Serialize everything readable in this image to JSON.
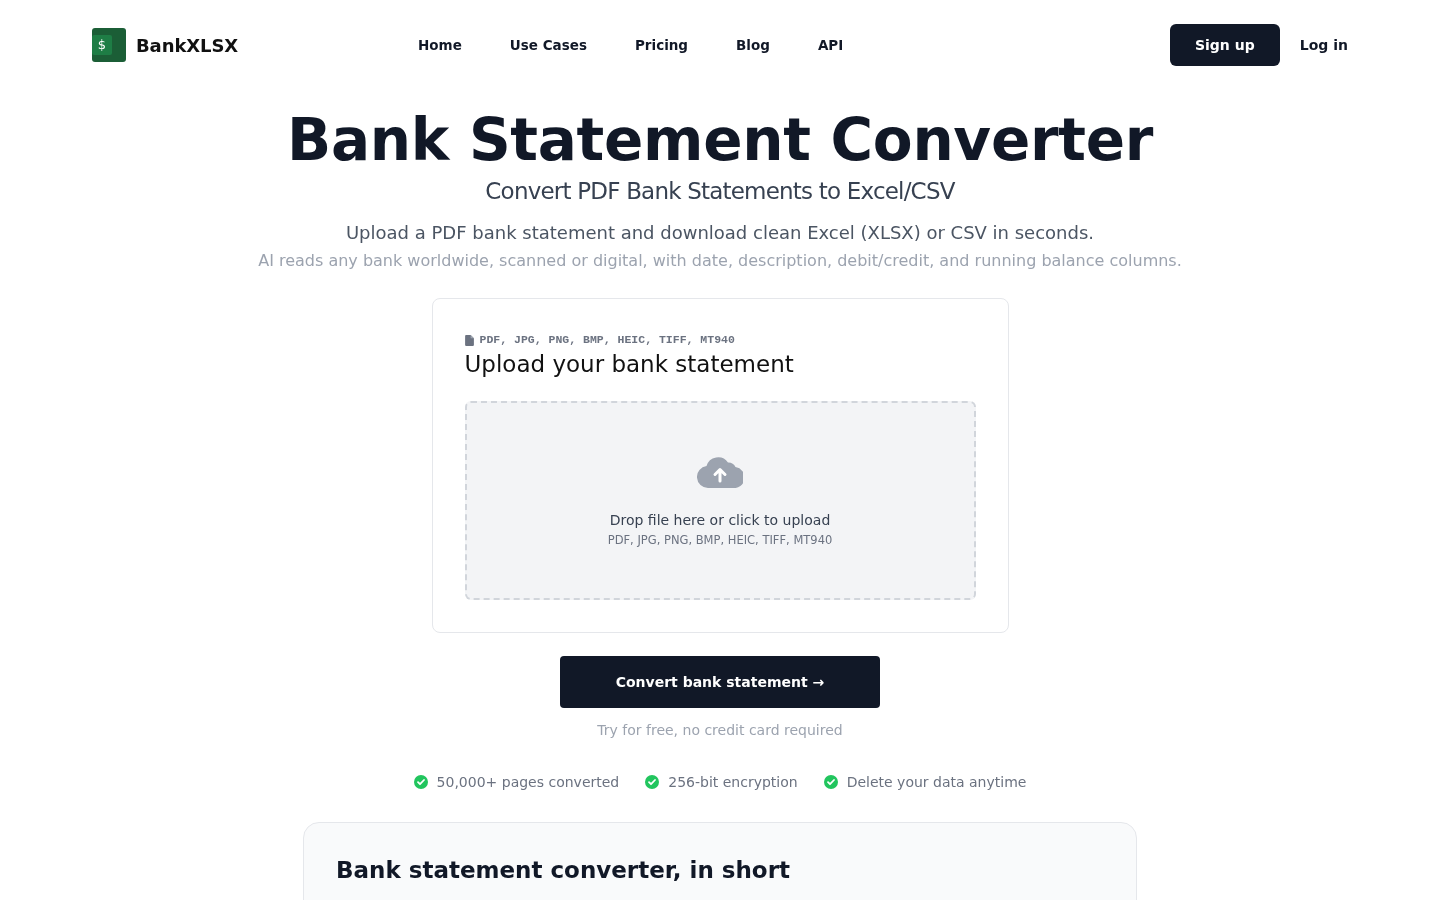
{
  "header": {
    "logo": {
      "symbol": "$",
      "text": "BankXLSX"
    },
    "nav": [
      {
        "label": "Home"
      },
      {
        "label": "Use Cases"
      },
      {
        "label": "Pricing"
      },
      {
        "label": "Blog"
      },
      {
        "label": "API"
      }
    ],
    "signup": "Sign up",
    "login": "Log in"
  },
  "hero": {
    "title": "Bank Statement Converter",
    "subtitle": "Convert PDF Bank Statements to Excel/CSV",
    "description": "Upload a PDF bank statement and download clean Excel (XLSX) or CSV in seconds.",
    "note": "AI reads any bank worldwide, scanned or digital, with date, description, debit/credit, and running balance columns."
  },
  "upload_card": {
    "formats_label": "PDF, JPG, PNG, BMP, HEIC, TIFF, MT940",
    "title": "Upload your bank statement",
    "dropzone": {
      "prompt": "Drop file here or click to upload",
      "formats": "PDF, JPG, PNG, BMP, HEIC, TIFF, MT940"
    }
  },
  "convert_button": "Convert bank statement →",
  "free_note": "Try for free, no credit card required",
  "highlights": [
    "50,000+ pages converted",
    "256-bit encryption",
    "Delete your data anytime"
  ],
  "summary": {
    "title": "Bank statement converter, in short"
  }
}
